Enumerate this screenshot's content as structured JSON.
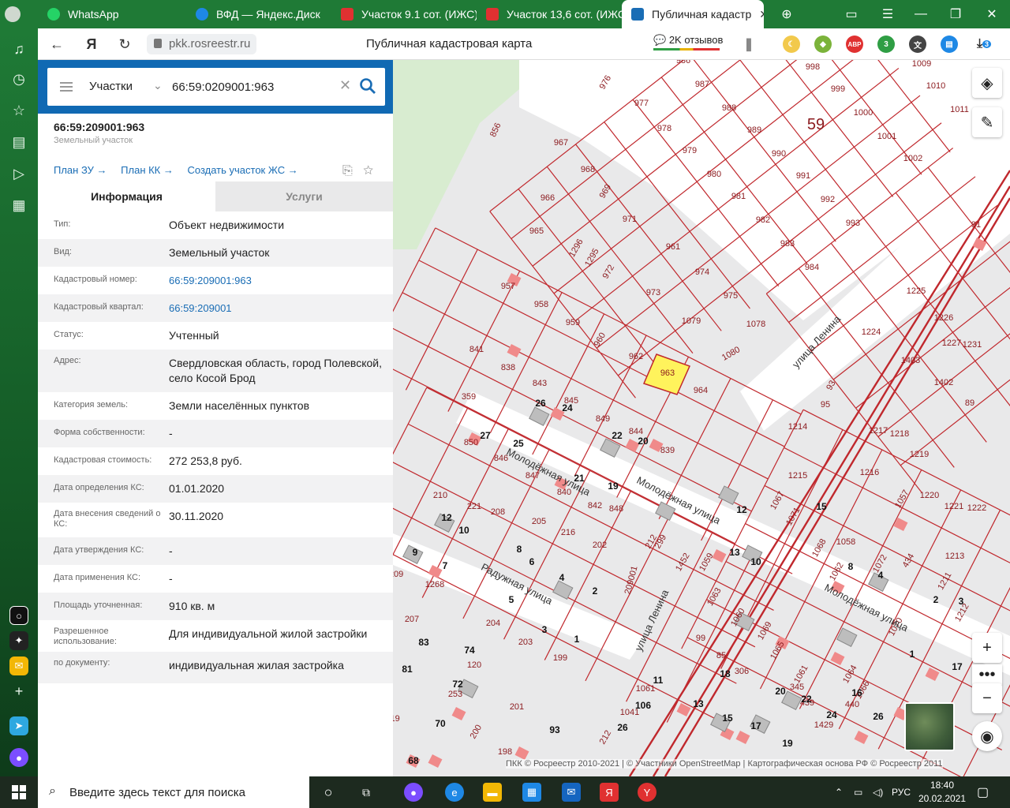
{
  "browser": {
    "tabs": [
      {
        "title": "WhatsApp",
        "favicon_color": "#25d366"
      },
      {
        "title": "ВФД — Яндекс.Диск",
        "favicon_color": "#1e88e5"
      },
      {
        "title": "Участок 9.1 сот. (ИЖС)",
        "favicon_color": "#e03131"
      },
      {
        "title": "Участок 13,6 сот. (ИЖС)",
        "favicon_color": "#e03131"
      },
      {
        "title": "Публичная кадастр",
        "favicon_color": "#1a6db5"
      }
    ],
    "url": "pkk.rosreestr.ru",
    "page_title": "Публичная кадастровая карта",
    "reviews_label": "2K отзывов",
    "ext_abp": "ABP",
    "ext_badge_3": "3",
    "download_badge": "3"
  },
  "search": {
    "type_label": "Участки",
    "query": "66:59:0209001:963"
  },
  "object": {
    "title": "66:59:209001:963",
    "subtitle": "Земельный участок",
    "links": [
      "План ЗУ →",
      "План КК →",
      "Создать участок ЖС →"
    ]
  },
  "tabs": {
    "info": "Информация",
    "services": "Услуги"
  },
  "rows": [
    {
      "key": "Тип:",
      "value": "Объект недвижимости",
      "h": 35
    },
    {
      "key": "Вид:",
      "value": "Земельный участок",
      "h": 35
    },
    {
      "key": "Кадастровый номер:",
      "value": "66:59:209001:963",
      "h": 35,
      "link": true
    },
    {
      "key": "Кадастровый квартал:",
      "value": "66:59:209001",
      "h": 35,
      "link": true
    },
    {
      "key": "Статус:",
      "value": "Учтенный",
      "h": 35
    },
    {
      "key": "Адрес:",
      "value": "Свердловская область, город Полевской, село Косой Брод",
      "h": 54
    },
    {
      "key": "Категория земель:",
      "value": "Земли населённых пунктов",
      "h": 35
    },
    {
      "key": "Форма собственности:",
      "value": "-",
      "h": 35
    },
    {
      "key": "Кадастровая стоимость:",
      "value": "272 253,8 руб.",
      "h": 35
    },
    {
      "key": "Дата определения КС:",
      "value": "01.01.2020",
      "h": 35
    },
    {
      "key": "Дата внесения сведений о КС:",
      "value": "30.11.2020",
      "h": 44
    },
    {
      "key": "Дата утверждения КС:",
      "value": "-",
      "h": 35
    },
    {
      "key": "Дата применения КС:",
      "value": "-",
      "h": 35
    },
    {
      "key": "Площадь уточненная:",
      "value": "910 кв. м",
      "h": 35
    },
    {
      "key": "Разрешенное использование:",
      "value": "Для индивидуальной жилой застройки",
      "h": 40
    },
    {
      "key": "по документу:",
      "value": "индивидуальная жилая застройка",
      "h": 40
    }
  ],
  "map": {
    "attribution": "ПКК © Росреестр 2010-2021 | © Участники OpenStreetMap | Картографическая основа РФ © Росреестр 2011",
    "colors": {
      "parcel_line": "#c0282d",
      "selected_fill": "#fff35c",
      "forest": "#d8ecd0",
      "building": "#f08a8a"
    },
    "parcel_labels": [
      "986",
      "987",
      "988",
      "989",
      "990",
      "991",
      "992",
      "993",
      "998",
      "999",
      "1000",
      "1001",
      "1002",
      "1009",
      "1010",
      "1011",
      "976",
      "977",
      "978",
      "979",
      "980",
      "981",
      "982",
      "983",
      "984",
      "856",
      "967",
      "968",
      "966",
      "969",
      "971",
      "965",
      "1296",
      "1295",
      "972",
      "961",
      "974",
      "975",
      "957",
      "958",
      "959",
      "960",
      "973",
      "1079",
      "1078",
      "1080",
      "841",
      "838",
      "843",
      "845",
      "962",
      "963",
      "964",
      "849",
      "844",
      "839",
      "359",
      "850",
      "846",
      "847",
      "840",
      "842",
      "848",
      "210",
      "221",
      "208",
      "205",
      "216",
      "202",
      "209",
      "1268",
      "207",
      "204",
      "203",
      "199",
      "120",
      "253",
      "201",
      "200",
      "198",
      "119",
      "1322",
      "212",
      "209001",
      "299",
      "1452",
      "1059",
      "1063",
      "1060",
      "1069",
      "1065",
      "1061",
      "1064",
      "1066",
      "1070",
      "1057",
      "1067",
      "1071",
      "1068",
      "1058",
      "1062",
      "1072",
      "434",
      "1211",
      "1212",
      "1213",
      "1214",
      "1215",
      "1216",
      "1217",
      "1218",
      "1219",
      "1220",
      "1221",
      "1222",
      "1223",
      "1224",
      "1225",
      "1226",
      "1227",
      "1231",
      "1403",
      "1402",
      "89",
      "91",
      "92",
      "93",
      "95",
      "99",
      "85",
      "306",
      "345",
      "439",
      "440",
      "1429",
      "1061",
      "1041",
      "212"
    ],
    "house_numbers": [
      "27",
      "25",
      "26",
      "24",
      "22",
      "20",
      "21",
      "19",
      "12",
      "10",
      "8",
      "6",
      "4",
      "2",
      "9",
      "7",
      "5",
      "3",
      "1",
      "83",
      "81",
      "74",
      "72",
      "70",
      "68",
      "93",
      "11",
      "106",
      "26",
      "13",
      "15",
      "17",
      "19",
      "18",
      "20",
      "22",
      "24",
      "26",
      "16",
      "12",
      "15",
      "13",
      "10",
      "8",
      "4",
      "2",
      "3",
      "1",
      "17"
    ],
    "streets": [
      "Молодёжная улица",
      "Молодёжная улица",
      "Молодёжная улица",
      "Радужная улица",
      "улица Ленина",
      "улица Ленина"
    ],
    "quarter_label": "59"
  },
  "taskbar": {
    "search_placeholder": "Введите здесь текст для поиска",
    "lang": "РУС",
    "time": "18:40",
    "date": "20.02.2021"
  }
}
